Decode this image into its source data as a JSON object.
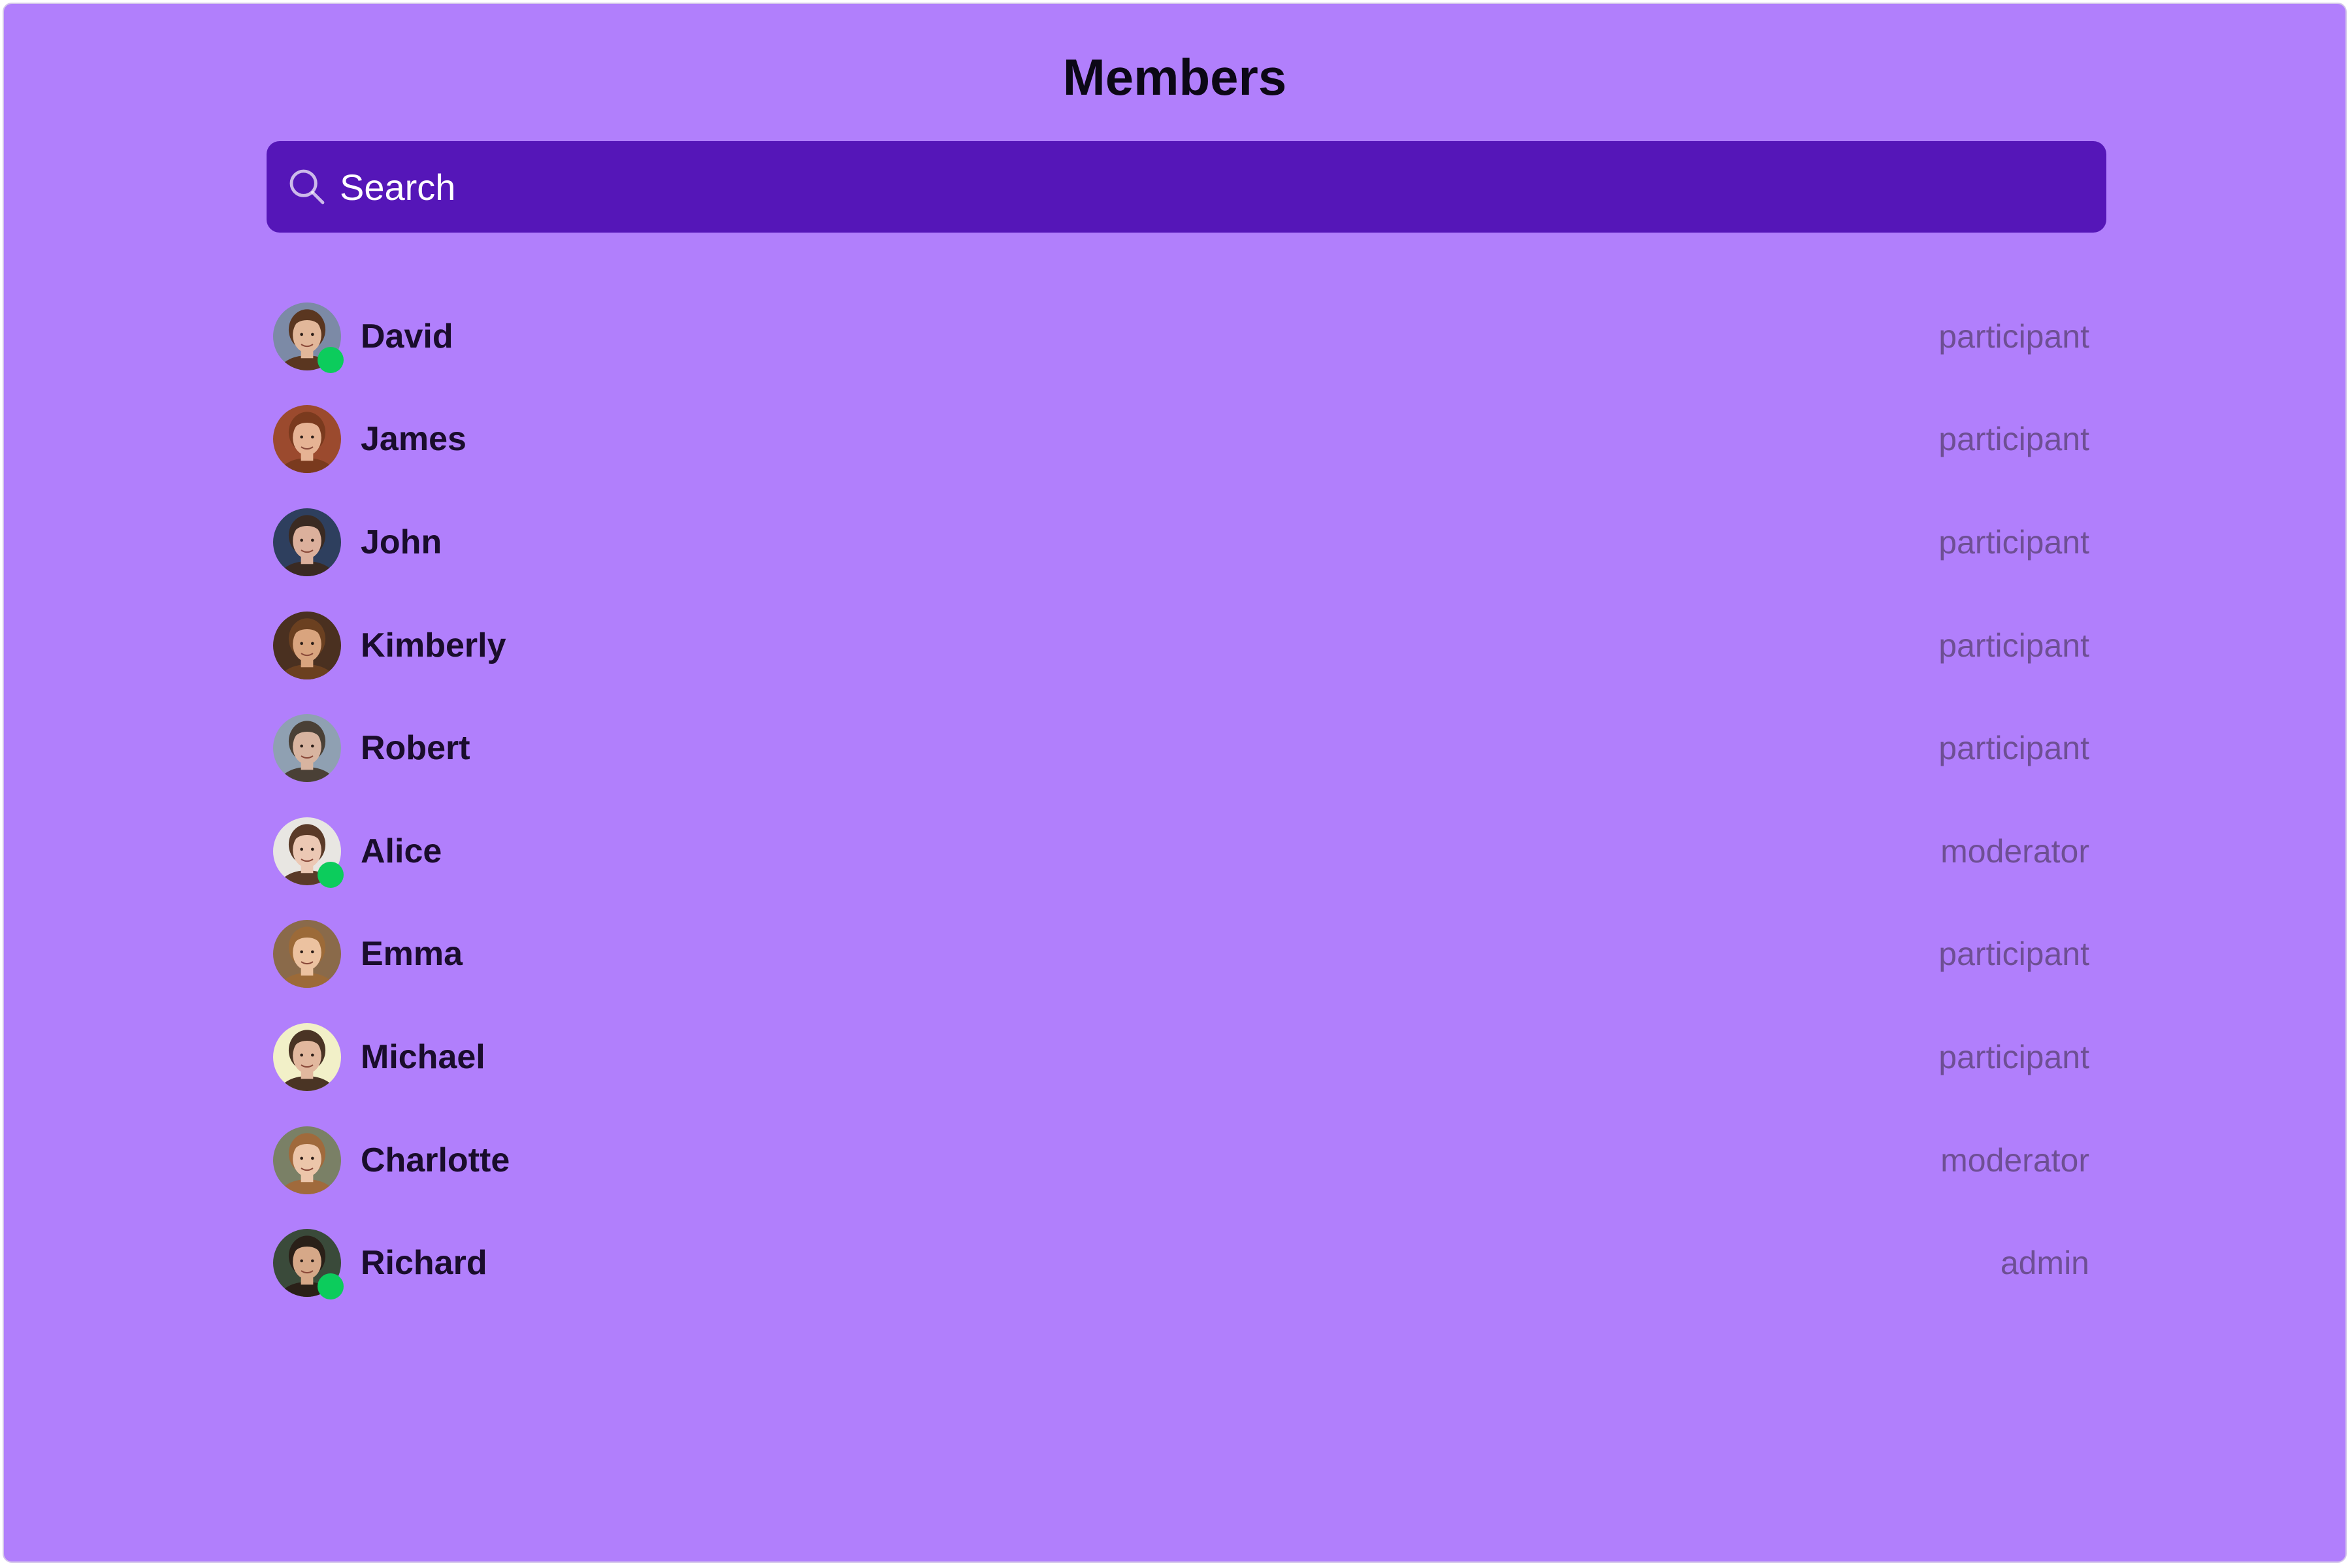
{
  "header": {
    "title": "Members"
  },
  "search": {
    "placeholder": "Search",
    "value": ""
  },
  "colors": {
    "background": "#b17ffc",
    "search_bar": "#5516b8",
    "online_status": "#0ccc5c",
    "name_text": "#1a0d2c",
    "role_text": "#6e4f94"
  },
  "members": [
    {
      "name": "David",
      "role": "participant",
      "online": true,
      "skin": "#e2b79a",
      "hair": "#5a3620",
      "bg": "#7c8aa6"
    },
    {
      "name": "James",
      "role": "participant",
      "online": false,
      "skin": "#e6b394",
      "hair": "#7a3a1e",
      "bg": "#9b4a2e"
    },
    {
      "name": "John",
      "role": "participant",
      "online": false,
      "skin": "#dcb09c",
      "hair": "#3a2a22",
      "bg": "#2e3f5e"
    },
    {
      "name": "Kimberly",
      "role": "participant",
      "online": false,
      "skin": "#d9a47e",
      "hair": "#6b4020",
      "bg": "#4a3020"
    },
    {
      "name": "Robert",
      "role": "participant",
      "online": false,
      "skin": "#d8b4a0",
      "hair": "#4a4036",
      "bg": "#8fa0b2"
    },
    {
      "name": "Alice",
      "role": "moderator",
      "online": true,
      "skin": "#ecc8b4",
      "hair": "#5a3a28",
      "bg": "#e8e6e2"
    },
    {
      "name": "Emma",
      "role": "participant",
      "online": false,
      "skin": "#ecc2a0",
      "hair": "#9c6a38",
      "bg": "#8a6a4a"
    },
    {
      "name": "Michael",
      "role": "participant",
      "online": false,
      "skin": "#e2b89e",
      "hair": "#4a3424",
      "bg": "#f2f0c8"
    },
    {
      "name": "Charlotte",
      "role": "moderator",
      "online": false,
      "skin": "#ecc6aa",
      "hair": "#a06a3c",
      "bg": "#7a8066"
    },
    {
      "name": "Richard",
      "role": "admin",
      "online": true,
      "skin": "#d6a888",
      "hair": "#2a2018",
      "bg": "#3a4a3a"
    }
  ]
}
